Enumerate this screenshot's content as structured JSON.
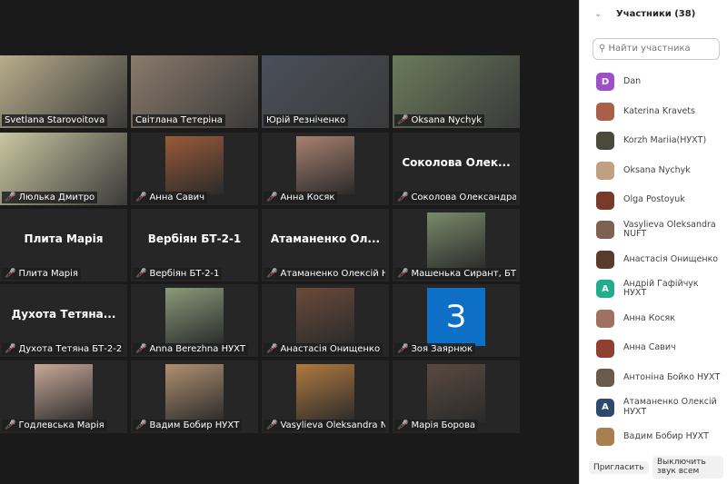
{
  "gallery": {
    "tiles": [
      {
        "name": "Svetlana Starovoitova",
        "mode": "video",
        "muted": false,
        "color": "#b8ad8a"
      },
      {
        "name": "Світлана Тетеріна",
        "mode": "video",
        "muted": false,
        "color": "#8a7a6a"
      },
      {
        "name": "Юрій Резніченко",
        "mode": "video",
        "muted": false,
        "active": true,
        "color": "#4a4f5a"
      },
      {
        "name": "Oksana Nychyk",
        "mode": "video",
        "muted": true,
        "color": "#6a7a5a"
      },
      {
        "name": "Люлька Дмитро",
        "mode": "video",
        "muted": true,
        "color": "#c9c6a0"
      },
      {
        "name": "Анна Савич",
        "mode": "pic",
        "muted": true,
        "color": "#9a5a3a"
      },
      {
        "name": "Анна Косяк",
        "mode": "pic",
        "muted": true,
        "color": "#a88070"
      },
      {
        "name": "Соколова Олександра ...",
        "mode": "text",
        "big": "Соколова  Олек...",
        "muted": true
      },
      {
        "name": "Плита Марія",
        "mode": "text",
        "big": "Плита Марія",
        "muted": true
      },
      {
        "name": "Вербіян БТ-2-1",
        "mode": "text",
        "big": "Вербіян БТ-2-1",
        "muted": true
      },
      {
        "name": "Атаманенко Олексій НУ...",
        "mode": "text",
        "big": "Атаманенко  Ол...",
        "muted": true
      },
      {
        "name": "Машенька Сирант, БТ-...",
        "mode": "pic",
        "muted": true,
        "color": "#7a8a6a"
      },
      {
        "name": "Духота Тетяна БТ-2-2",
        "mode": "text",
        "big": "Духота  Тетяна...",
        "muted": true
      },
      {
        "name": "Anna Berezhna НУХТ",
        "mode": "pic",
        "muted": true,
        "color": "#8a9a7a"
      },
      {
        "name": "Анастасія Онищенко",
        "mode": "pic",
        "muted": true,
        "color": "#6a4a3a"
      },
      {
        "name": "Зоя Заярнюк",
        "mode": "initial",
        "initial": "З",
        "muted": true,
        "color": "#0e6fc7"
      },
      {
        "name": "Годлевська Марія",
        "mode": "pic",
        "muted": true,
        "color": "#c8a898"
      },
      {
        "name": "Вадим Бобир НУХТ",
        "mode": "pic",
        "muted": true,
        "color": "#b09070"
      },
      {
        "name": "Vasylieva Oleksandra N...",
        "mode": "pic",
        "muted": true,
        "color": "#b07a40"
      },
      {
        "name": "Марія Борова",
        "mode": "pic",
        "muted": true,
        "color": "#5a4a40"
      }
    ]
  },
  "panel": {
    "title": "Участники (38)",
    "search_placeholder": "Найти участника",
    "participants": [
      {
        "name": "Dan",
        "initial": "D",
        "color": "#9b4fc9"
      },
      {
        "name": "Katerina Kravets",
        "color": "#a8604a"
      },
      {
        "name": "Korzh Mariia(НУХТ)",
        "color": "#4a4a3a"
      },
      {
        "name": "Oksana Nychyk",
        "color": "#c0a080"
      },
      {
        "name": "Olga Postoyuk",
        "color": "#7a3a2a"
      },
      {
        "name": "Vasylieva Oleksandra NUFT",
        "color": "#806050"
      },
      {
        "name": "Анастасія Онищенко",
        "color": "#5a3a2a"
      },
      {
        "name": "Андрій Гафійчук НУХТ",
        "initial": "A",
        "color": "#1fae8a"
      },
      {
        "name": "Анна Косяк",
        "color": "#a07060"
      },
      {
        "name": "Анна Савич",
        "color": "#904030"
      },
      {
        "name": "Антоніна Бойко НУХТ",
        "color": "#6a5a4a"
      },
      {
        "name": "Атаманенко Олексій НУХТ",
        "initial": "A",
        "color": "#2d4a6e"
      },
      {
        "name": "Вадим Бобир НУХТ",
        "color": "#a88050"
      }
    ],
    "invite_label": "Пригласить",
    "mute_label": "Выключить звук всем"
  }
}
